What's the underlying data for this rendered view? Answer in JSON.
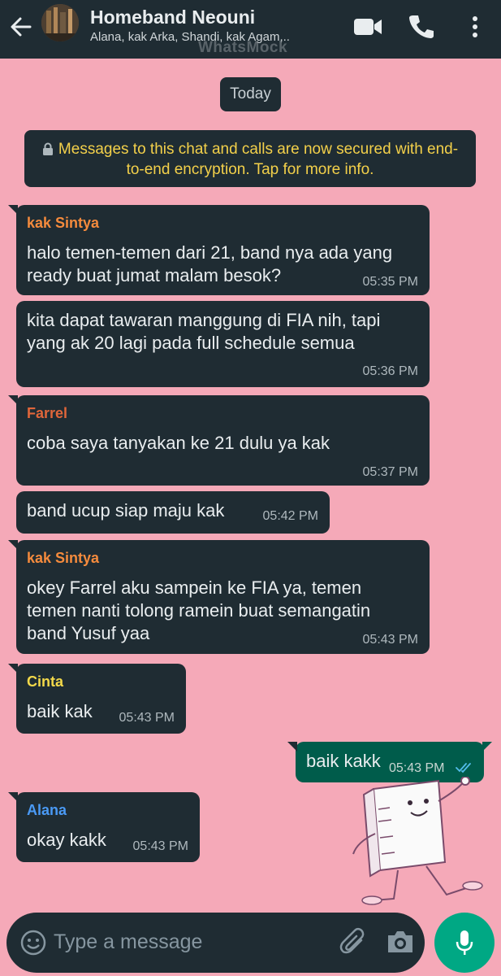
{
  "header": {
    "title": "Homeband Neouni",
    "members": "Alana, kak Arka, Shandi, kak Agam,..",
    "watermark": "WhatsMock",
    "icons": [
      "back-arrow-icon",
      "group-avatar",
      "video-call-icon",
      "phone-icon",
      "more-vert-icon"
    ]
  },
  "date_chip": "Today",
  "encryption_notice": "Messages to this chat and calls are now secured with end-to-end encryption. Tap for more info.",
  "messages": [
    {
      "sender": "kak Sintya",
      "sender_color": "#f58b3d",
      "lines": [
        "halo temen-temen dari 21, band nya ada yang",
        "ready buat jumat malam besok?"
      ],
      "time": "05:35 PM"
    },
    {
      "sender": "",
      "lines": [
        "kita dapat tawaran manggung di FIA nih, tapi",
        "yang ak 20 lagi pada full schedule semua"
      ],
      "time": "05:36 PM"
    },
    {
      "sender": "Farrel",
      "sender_color": "#e0663a",
      "lines": [
        "coba saya tanyakan ke 21 dulu ya kak"
      ],
      "time": "05:37 PM"
    },
    {
      "sender": "",
      "lines": [
        "band ucup siap maju kak"
      ],
      "time": "05:42 PM"
    },
    {
      "sender": "kak Sintya",
      "sender_color": "#f58b3d",
      "lines": [
        "okey Farrel aku sampein ke FIA ya, temen",
        "temen nanti tolong ramein buat semangatin",
        "band Yusuf yaa"
      ],
      "time": "05:43 PM"
    },
    {
      "sender": "Cinta",
      "sender_color": "#f3d94a",
      "lines": [
        "baik kak"
      ],
      "time": "05:43 PM"
    },
    {
      "sender": "You",
      "outgoing": true,
      "lines": [
        "baik kakk"
      ],
      "time": "05:43 PM",
      "status": "read"
    },
    {
      "sender": "Alana",
      "sender_color": "#4a9af5",
      "lines": [
        "okay kakk"
      ],
      "time": "05:43 PM"
    }
  ],
  "input": {
    "placeholder": "Type a message",
    "icons": [
      "emoji-icon",
      "attach-icon",
      "camera-icon",
      "mic-icon"
    ]
  },
  "colors": {
    "wallpaper": "#f5a9b8",
    "bubble_in": "#1f2c33",
    "bubble_out": "#005c4b",
    "accent": "#00a884",
    "read_tick": "#53bdeb"
  }
}
